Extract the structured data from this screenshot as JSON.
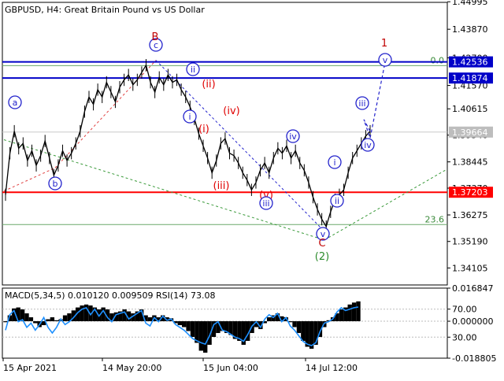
{
  "chart_data": [
    {
      "type": "line",
      "symbol": "GBPUSD",
      "timeframe": "H4",
      "description": "Great Britain Pound vs US Dollar",
      "ylim": [
        1.3341,
        1.4497
      ],
      "y_ticks": [
        "1.44995",
        "1.43870",
        "1.42700",
        "1.41570",
        "1.40615",
        "1.39540",
        "1.38445",
        "1.37370",
        "1.36275",
        "1.35190",
        "1.34105"
      ],
      "x_labels": [
        "15 Apr 2021",
        "14 May 20:00",
        "15 Jun 04:00",
        "14 Jul 12:00"
      ],
      "price_levels": [
        {
          "value": 1.42536,
          "label": "1.42536",
          "color": "#0000c8",
          "style": "box"
        },
        {
          "value": 1.41874,
          "label": "1.41874",
          "color": "#0000c8",
          "style": "box"
        },
        {
          "value": 1.39664,
          "label": "1.39664",
          "color": "#bdbdbd",
          "style": "box"
        },
        {
          "value": 1.37203,
          "label": "1.37203",
          "color": "#ff0000",
          "style": "box"
        }
      ],
      "fib_levels": [
        {
          "label": "0.0",
          "value": 1.4238
        },
        {
          "label": "23.6",
          "value": 1.3588
        }
      ],
      "price": [
        1.371,
        1.388,
        1.397,
        1.39,
        1.392,
        1.385,
        1.389,
        1.383,
        1.387,
        1.393,
        1.386,
        1.379,
        1.383,
        1.389,
        1.385,
        1.388,
        1.392,
        1.397,
        1.405,
        1.411,
        1.408,
        1.414,
        1.411,
        1.417,
        1.413,
        1.409,
        1.415,
        1.418,
        1.42,
        1.416,
        1.418,
        1.421,
        1.424,
        1.417,
        1.413,
        1.419,
        1.416,
        1.42,
        1.417,
        1.418,
        1.414,
        1.411,
        1.407,
        1.402,
        1.396,
        1.391,
        1.386,
        1.38,
        1.385,
        1.392,
        1.394,
        1.388,
        1.387,
        1.384,
        1.38,
        1.377,
        1.373,
        1.376,
        1.381,
        1.384,
        1.38,
        1.386,
        1.39,
        1.388,
        1.391,
        1.386,
        1.389,
        1.384,
        1.381,
        1.376,
        1.37,
        1.365,
        1.361,
        1.358,
        1.364,
        1.369,
        1.371,
        1.373,
        1.38,
        1.386,
        1.389,
        1.392,
        1.395,
        1.397
      ],
      "annotations": [
        {
          "text": "a",
          "color": "#2222cc",
          "circle": true
        },
        {
          "text": "b",
          "color": "#2222cc",
          "circle": true
        },
        {
          "text": "c",
          "color": "#2222cc",
          "circle": true
        },
        {
          "text": "B",
          "color": "#c00000",
          "circle": false
        },
        {
          "text": "i",
          "color": "#2222cc",
          "circle": true
        },
        {
          "text": "ii",
          "color": "#2222cc",
          "circle": true
        },
        {
          "text": "(ii)",
          "color": "#e00000",
          "circle": false
        },
        {
          "text": "(i)",
          "color": "#e00000",
          "circle": false
        },
        {
          "text": "(iv)",
          "color": "#e00000",
          "circle": false
        },
        {
          "text": "(iii)",
          "color": "#e00000",
          "circle": false
        },
        {
          "text": "(v)",
          "color": "#e00000",
          "circle": false
        },
        {
          "text": "iii",
          "color": "#2222cc",
          "circle": true
        },
        {
          "text": "iv",
          "color": "#2222cc",
          "circle": true
        },
        {
          "text": "v",
          "color": "#2222cc",
          "circle": true
        },
        {
          "text": "C",
          "color": "#c00000",
          "circle": false
        },
        {
          "text": "(2)",
          "color": "#2a8a2a",
          "circle": false
        },
        {
          "text": "i",
          "color": "#2222cc",
          "circle": true
        },
        {
          "text": "ii",
          "color": "#2222cc",
          "circle": true
        },
        {
          "text": "iii",
          "color": "#2222cc",
          "circle": true
        },
        {
          "text": "iv",
          "color": "#2222cc",
          "circle": true
        },
        {
          "text": "v",
          "color": "#2222cc",
          "circle": true
        },
        {
          "text": "1",
          "color": "#c00000",
          "circle": false
        }
      ],
      "forecast_path": [
        1.397,
        1.4018,
        1.3942,
        1.4268
      ]
    },
    {
      "type": "bar",
      "indicator": "MACD(5,34,5) 0.010120 0.009509 RSI(14) 73.08",
      "ylim": [
        -0.018805,
        0.016847
      ],
      "y_ticks": [
        "0.016847",
        "70.00",
        "0.000000",
        "30.00",
        "-0.018805"
      ],
      "macd_values": [
        -0.0005,
        0.003,
        0.0065,
        0.007,
        0.006,
        0.004,
        0.002,
        -0.001,
        -0.003,
        -0.002,
        0.001,
        0.002,
        0.0005,
        0.001,
        0.003,
        0.004,
        0.0055,
        0.007,
        0.008,
        0.0085,
        0.008,
        0.007,
        0.006,
        0.007,
        0.006,
        0.004,
        0.0045,
        0.005,
        0.006,
        0.005,
        0.004,
        0.005,
        0.006,
        0.003,
        0.002,
        0.003,
        0.002,
        0.003,
        0.002,
        0.0015,
        -0.001,
        -0.002,
        -0.003,
        -0.005,
        -0.008,
        -0.011,
        -0.015,
        -0.016,
        -0.012,
        -0.008,
        -0.006,
        -0.005,
        -0.006,
        -0.007,
        -0.009,
        -0.01,
        -0.012,
        -0.01,
        -0.006,
        -0.003,
        -0.004,
        -0.001,
        0.002,
        0.003,
        0.004,
        0.0025,
        0.002,
        -0.0005,
        -0.003,
        -0.006,
        -0.01,
        -0.013,
        -0.014,
        -0.012,
        -0.008,
        -0.003,
        0.0005,
        0.002,
        0.004,
        0.006,
        0.007,
        0.0085,
        0.0095,
        0.0101
      ],
      "rsi_values": [
        40,
        62,
        68,
        52,
        55,
        44,
        50,
        40,
        48,
        58,
        44,
        36,
        44,
        56,
        48,
        52,
        58,
        65,
        70,
        72,
        62,
        70,
        60,
        68,
        58,
        52,
        62,
        64,
        66,
        56,
        60,
        64,
        68,
        50,
        46,
        58,
        52,
        60,
        54,
        56,
        48,
        44,
        40,
        34,
        28,
        25,
        22,
        20,
        32,
        48,
        52,
        40,
        38,
        34,
        30,
        28,
        24,
        34,
        46,
        52,
        44,
        56,
        62,
        58,
        64,
        52,
        58,
        46,
        40,
        32,
        24,
        20,
        18,
        22,
        38,
        50,
        52,
        56,
        66,
        72,
        68,
        70,
        72,
        73
      ]
    }
  ]
}
